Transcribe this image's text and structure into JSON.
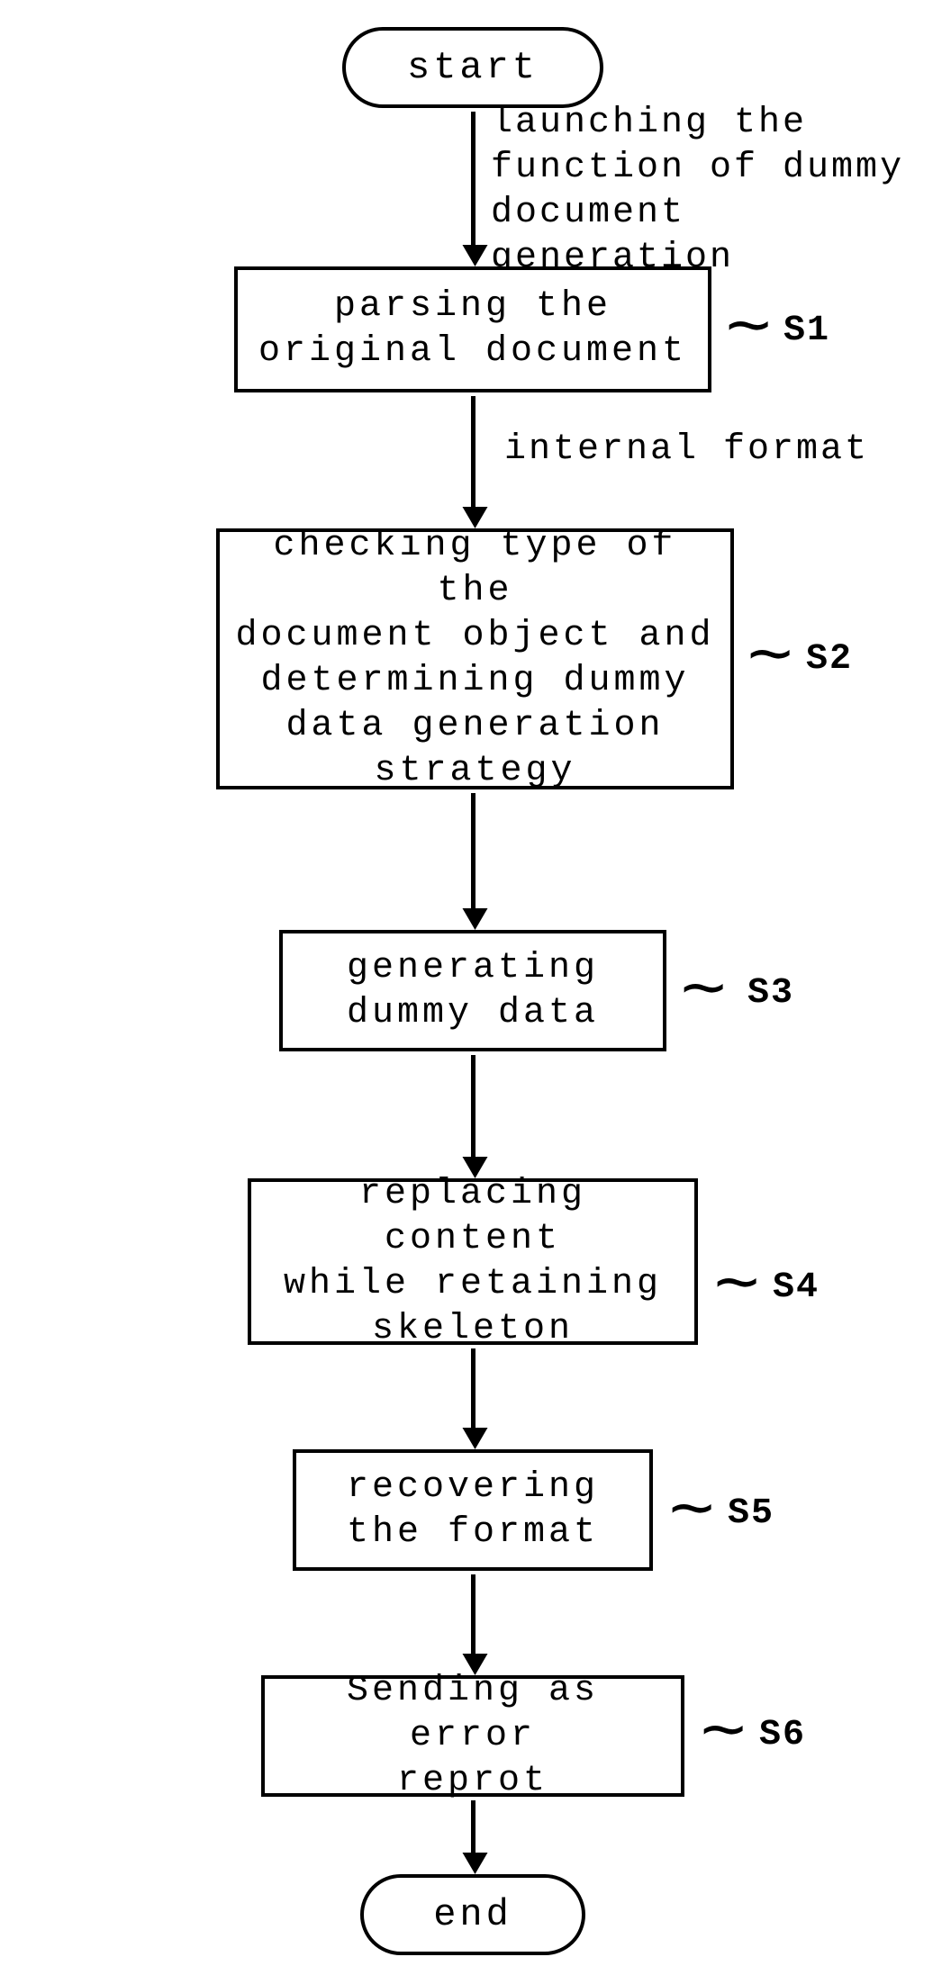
{
  "terminators": {
    "start": "start",
    "end": "end"
  },
  "steps": {
    "s1": {
      "text": "parsing the\noriginal document",
      "label": "S1"
    },
    "s2": {
      "text": "checking type of the\ndocument object and\ndetermining dummy\ndata generation\nstrategy",
      "label": "S2"
    },
    "s3": {
      "text": "generating\ndummy data",
      "label": "S3"
    },
    "s4": {
      "text": "replacing content\nwhile retaining\nskeleton",
      "label": "S4"
    },
    "s5": {
      "text": "recovering\nthe format",
      "label": "S5"
    },
    "s6": {
      "text": "Sending as error\nreprot",
      "label": "S6"
    }
  },
  "flowLabels": {
    "launch": "launching the\nfunction of dummy\ndocument generation",
    "internal": "internal format"
  }
}
